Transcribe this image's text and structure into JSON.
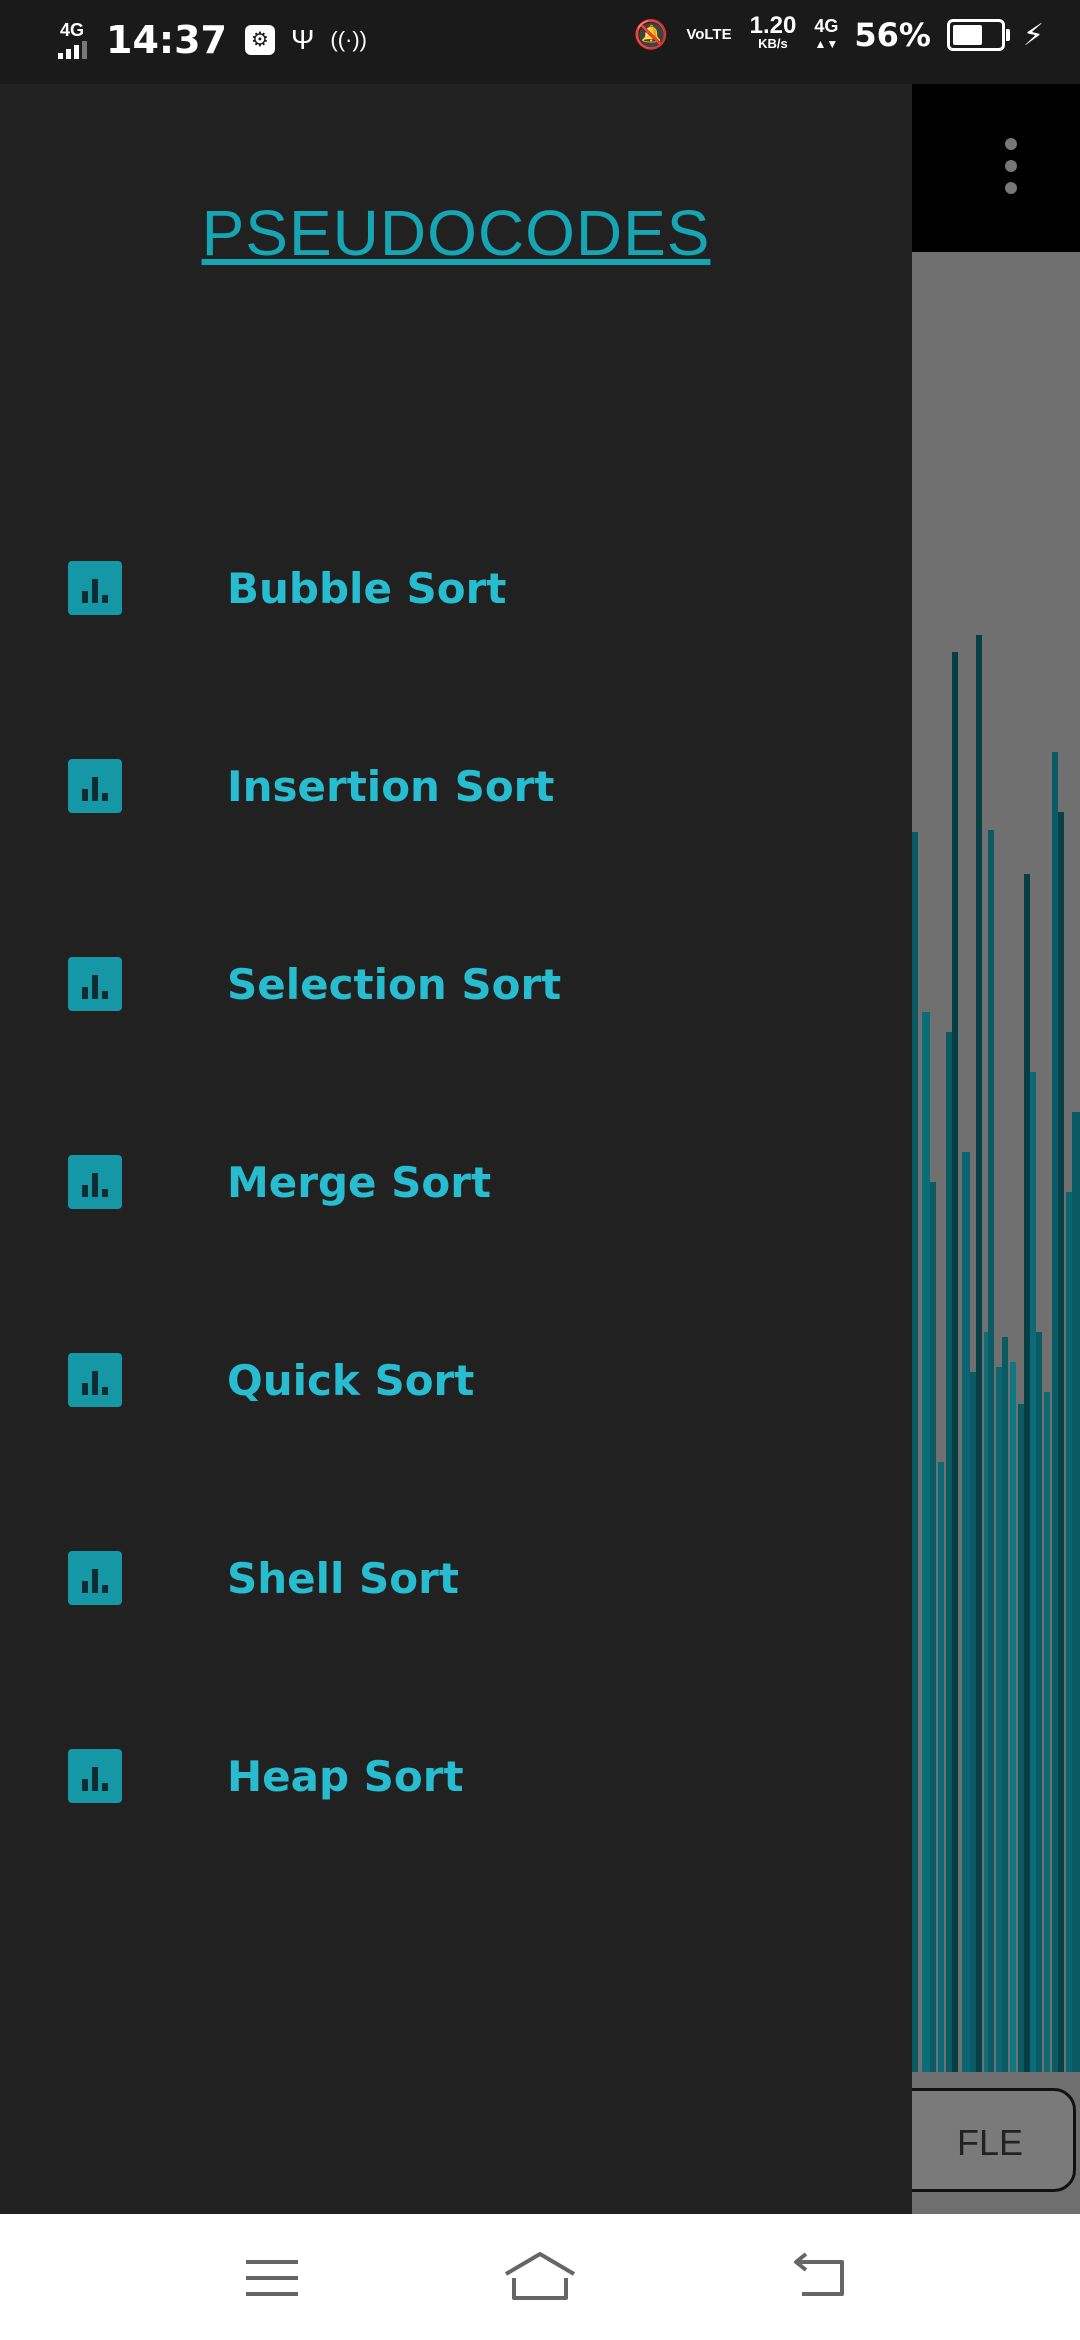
{
  "status_bar": {
    "network_type": "4G",
    "time": "14:37",
    "volte": "VoLTE",
    "speed_value": "1.20",
    "speed_unit": "KB/s",
    "network_type_2": "4G",
    "battery_percent": "56%",
    "battery_level": 0.56
  },
  "drawer": {
    "title": "PSEUDOCODES",
    "items": [
      {
        "label": "Bubble Sort",
        "icon": "bar-chart-icon"
      },
      {
        "label": "Insertion Sort",
        "icon": "bar-chart-icon"
      },
      {
        "label": "Selection Sort",
        "icon": "bar-chart-icon"
      },
      {
        "label": "Merge Sort",
        "icon": "bar-chart-icon"
      },
      {
        "label": "Quick Sort",
        "icon": "bar-chart-icon"
      },
      {
        "label": "Shell Sort",
        "icon": "bar-chart-icon"
      },
      {
        "label": "Heap Sort",
        "icon": "bar-chart-icon"
      }
    ]
  },
  "background_app": {
    "shuffle_button_visible_text": "FLE"
  },
  "colors": {
    "accent": "#16a5b3",
    "menu_text": "#27bcd0",
    "drawer_bg": "#212121",
    "bar_color": "#0a5a63"
  },
  "nav_bar": {
    "menu_icon": "menu-icon",
    "home_icon": "home-icon",
    "back_icon": "back-icon"
  }
}
